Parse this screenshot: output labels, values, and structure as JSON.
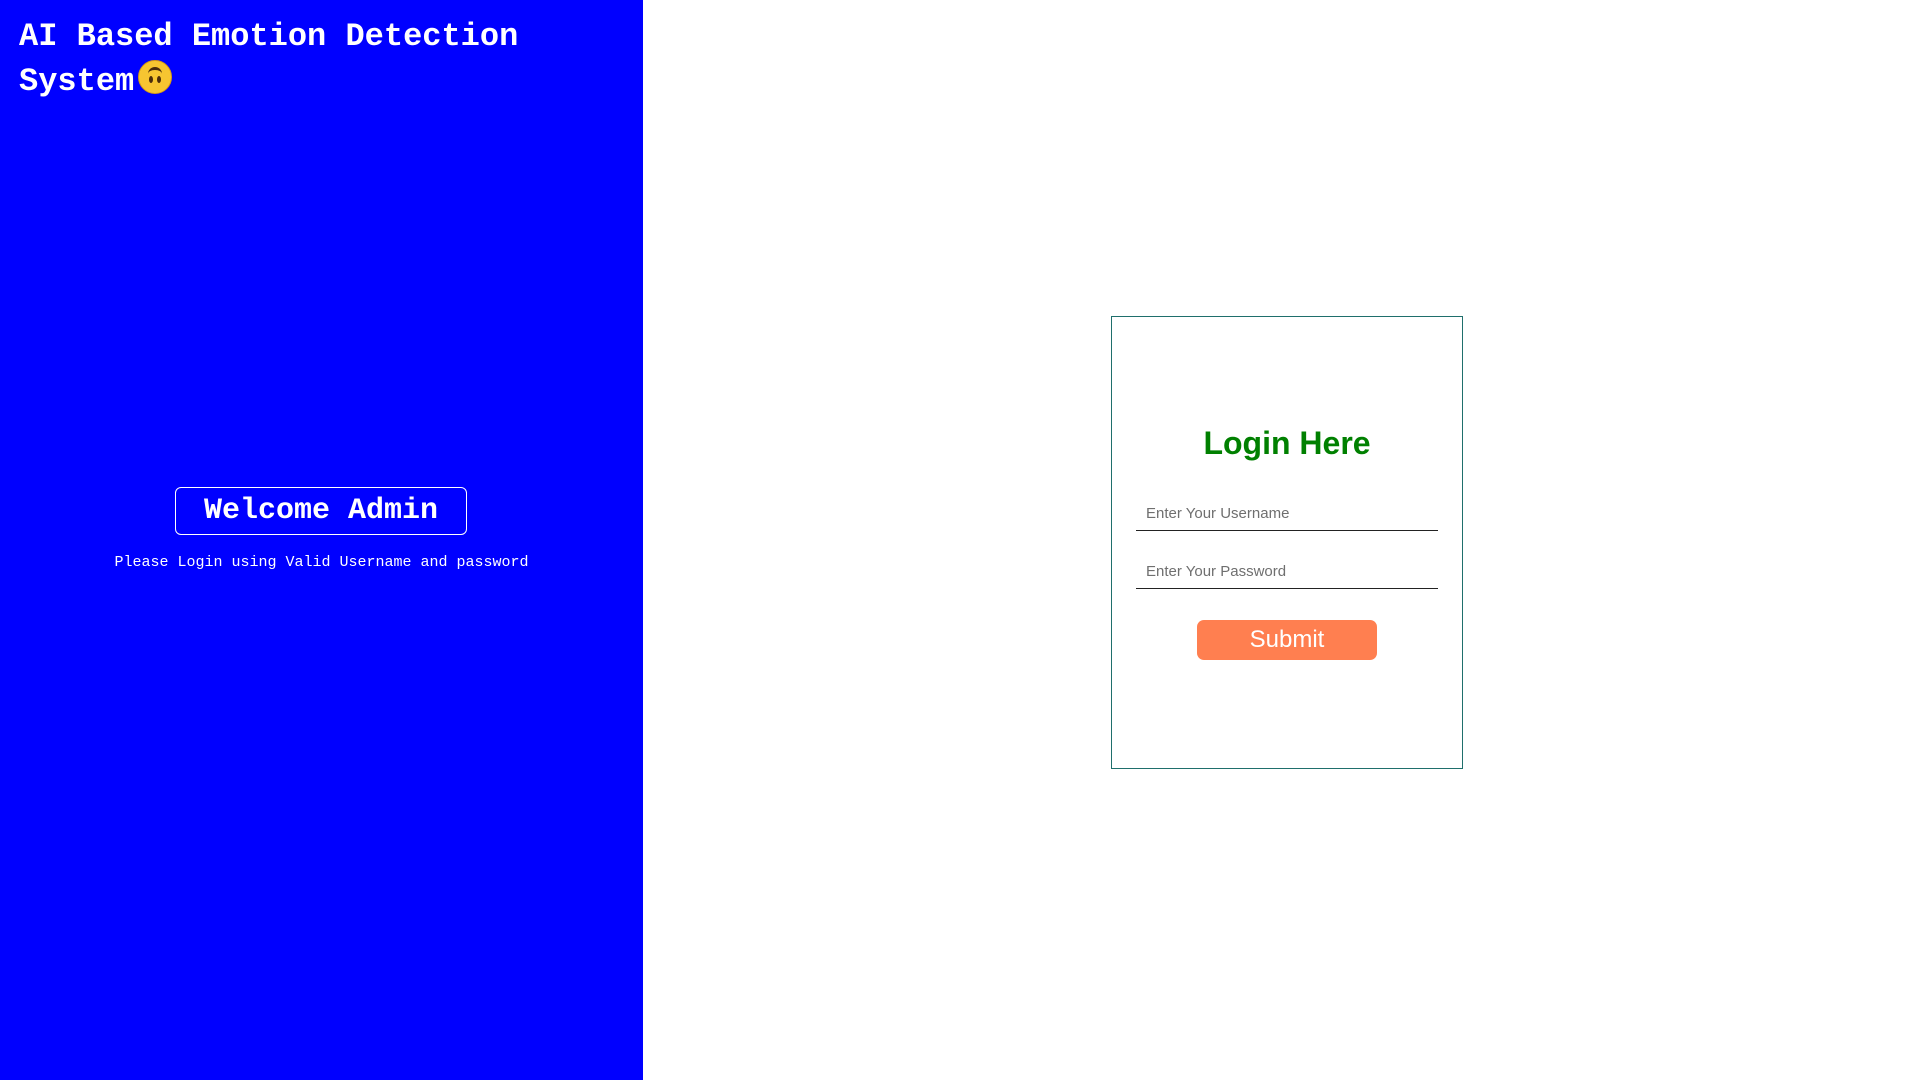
{
  "left_panel": {
    "app_title": "AI Based Emotion Detection System",
    "title_emoji_icon": "upside-down-face-icon",
    "welcome_heading": "Welcome Admin",
    "welcome_subtext": "Please Login using Valid Username and password"
  },
  "login": {
    "title": "Login Here",
    "username_placeholder": "Enter Your Username",
    "password_placeholder": "Enter Your Password",
    "submit_label": "Submit"
  },
  "colors": {
    "left_panel_background": "#0000ff",
    "login_title": "#008000",
    "submit_button": "#ff7f50",
    "card_border": "#1f6f6c"
  }
}
